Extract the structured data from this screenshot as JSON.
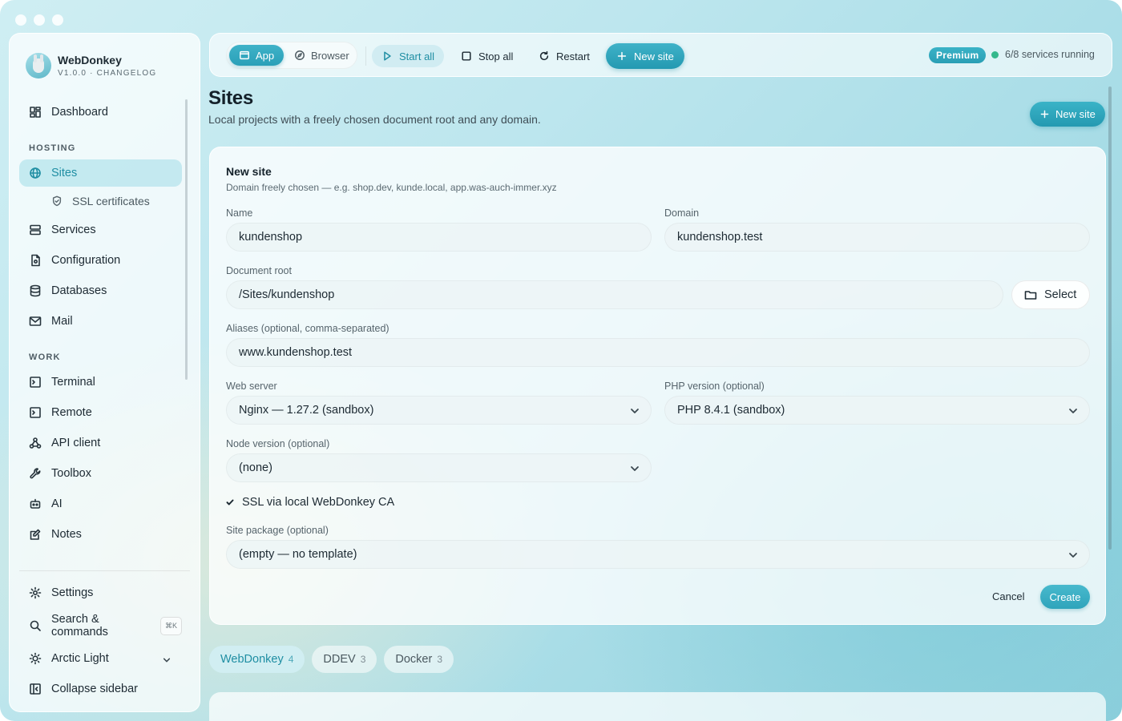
{
  "app": {
    "name": "WebDonkey",
    "version": "V1.0.0 · CHANGELOG"
  },
  "sidebar": {
    "dashboard": "Dashboard",
    "hosting_label": "HOSTING",
    "sites": "Sites",
    "ssl": "SSL certificates",
    "services": "Services",
    "configuration": "Configuration",
    "databases": "Databases",
    "mail": "Mail",
    "work_label": "WORK",
    "terminal": "Terminal",
    "remote": "Remote",
    "api_client": "API client",
    "toolbox": "Toolbox",
    "ai": "AI",
    "notes": "Notes",
    "settings": "Settings",
    "search": "Search & commands",
    "search_kbd": "⌘K",
    "theme": "Arctic Light",
    "collapse": "Collapse sidebar"
  },
  "toolbar": {
    "app": "App",
    "browser": "Browser",
    "start_all": "Start all",
    "stop_all": "Stop all",
    "restart": "Restart",
    "new_site": "New site",
    "premium": "Premium",
    "status": "6/8 services running"
  },
  "page": {
    "title": "Sites",
    "subtitle": "Local projects with a freely chosen document root and any domain.",
    "new_site": "New site"
  },
  "form": {
    "title": "New site",
    "subtitle": "Domain freely chosen — e.g. shop.dev, kunde.local, app.was-auch-immer.xyz",
    "name_label": "Name",
    "name_value": "kundenshop",
    "domain_label": "Domain",
    "domain_value": "kundenshop.test",
    "docroot_label": "Document root",
    "docroot_value": "/Sites/kundenshop",
    "select": "Select",
    "aliases_label": "Aliases (optional, comma-separated)",
    "aliases_value": "www.kundenshop.test",
    "webserver_label": "Web server",
    "webserver_value": "Nginx — 1.27.2 (sandbox)",
    "php_label": "PHP version (optional)",
    "php_value": "PHP 8.4.1 (sandbox)",
    "node_label": "Node version (optional)",
    "node_value": "(none)",
    "ssl": "SSL via local WebDonkey CA",
    "package_label": "Site package (optional)",
    "package_value": "(empty — no template)",
    "cancel": "Cancel",
    "create": "Create"
  },
  "tabs": [
    {
      "label": "WebDonkey",
      "count": "4"
    },
    {
      "label": "DDEV",
      "count": "3"
    },
    {
      "label": "Docker",
      "count": "3"
    }
  ],
  "colors": {
    "accent": "#2aa0b8",
    "status_ok": "#35b88d"
  }
}
